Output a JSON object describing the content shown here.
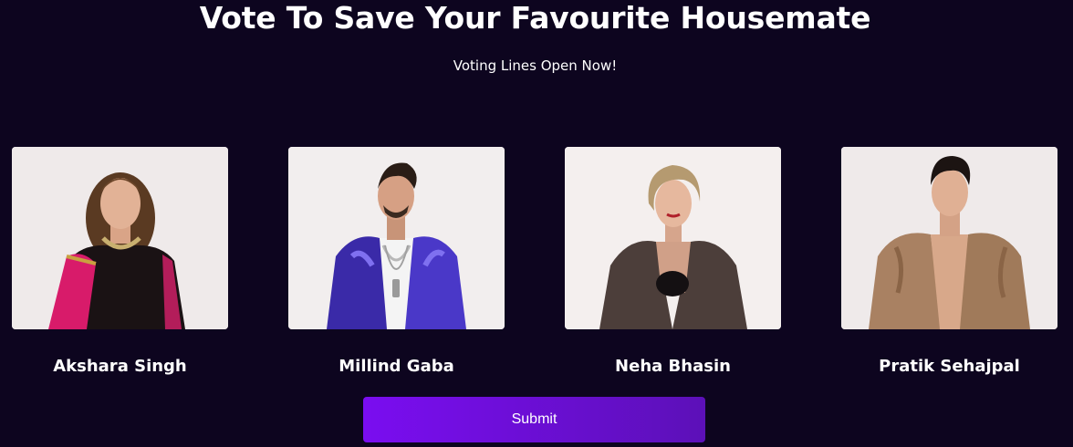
{
  "header": {
    "title": "Vote To Save Your Favourite Housemate",
    "subtitle": "Voting Lines Open Now!"
  },
  "housemates": [
    {
      "name": "Akshara Singh",
      "photo_icon": "housemate-photo"
    },
    {
      "name": "Millind Gaba",
      "photo_icon": "housemate-photo"
    },
    {
      "name": "Neha Bhasin",
      "photo_icon": "housemate-photo"
    },
    {
      "name": "Pratik Sehajpal",
      "photo_icon": "housemate-photo"
    }
  ],
  "actions": {
    "submit_label": "Submit"
  },
  "colors": {
    "background": "#0d051f",
    "button_start": "#7a0df0",
    "button_end": "#5c10b8",
    "text": "#ffffff"
  }
}
